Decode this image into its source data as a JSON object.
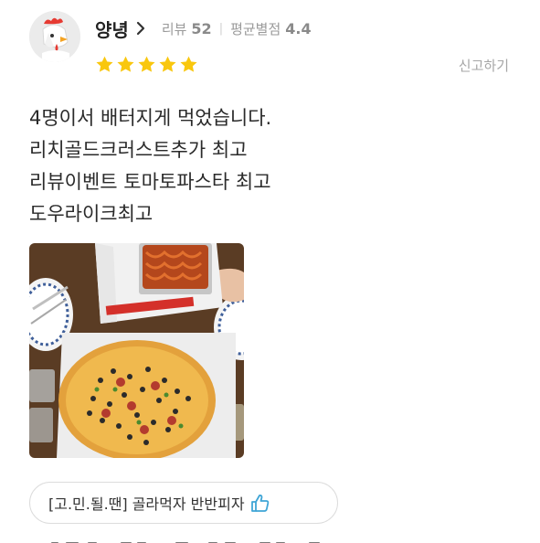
{
  "reviewer": {
    "nickname": "양녕",
    "review_count_label": "리뷰",
    "review_count": "52",
    "avg_rating_label": "평균별점",
    "avg_rating": "4.4",
    "rating_stars": 5,
    "star_color": "#f9c70e"
  },
  "actions": {
    "report_label": "신고하기"
  },
  "review": {
    "lines": [
      "4명이서 배터지게 먹었습니다.",
      "리치골드크러스트추가 최고",
      "리뷰이벤트 토마토파스타 최고",
      "도우라이크최고"
    ]
  },
  "menu": {
    "item": "[고.민.될.땐] 골라먹자 반반피자",
    "icon": "thumbs-up-icon",
    "icon_color": "#3fa5d6"
  }
}
